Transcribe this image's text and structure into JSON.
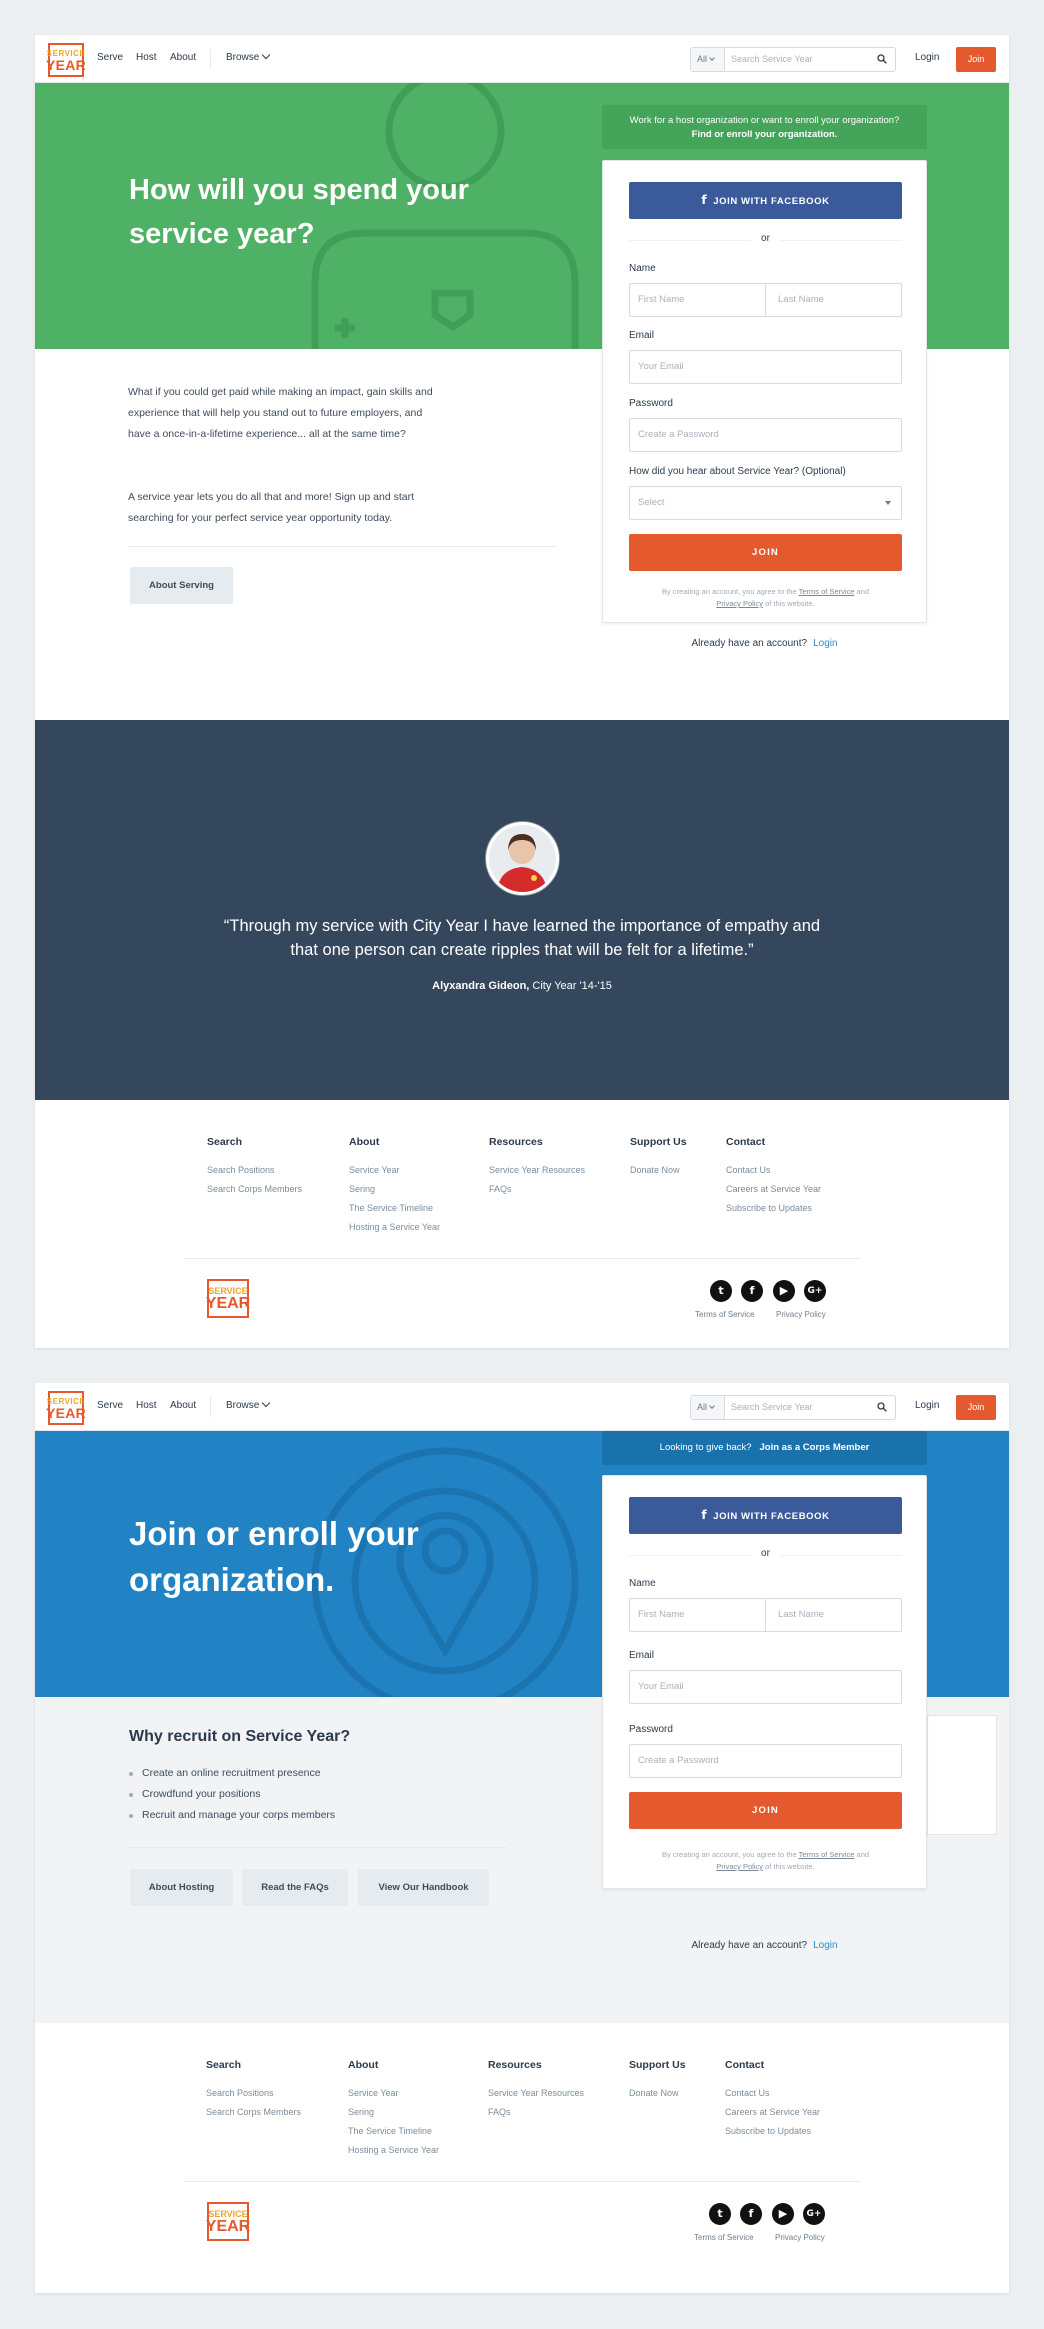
{
  "nav": {
    "logo_top": "SERVICE",
    "logo_bottom": "YEAR",
    "links": [
      "Serve",
      "Host",
      "About"
    ],
    "browse": "Browse",
    "search_category": "All",
    "search_placeholder": "Search Service Year",
    "login": "Login",
    "join": "Join"
  },
  "serve_page": {
    "hero_title": "How will you spend your service year?",
    "banner_line1": "Work for a host organization or want to enroll your organization?",
    "banner_line2": "Find or enroll your organization.",
    "intro_p1": "What if you could get paid while making an impact, gain skills and experience that will help you stand out to future employers, and have a once-in-a-lifetime experience... all at the same time?",
    "intro_p2": "A service year lets you do all that and more! Sign up and start searching for your perfect service year opportunity today.",
    "about_button": "About Serving",
    "form": {
      "facebook": "JOIN WITH FACEBOOK",
      "or": "or",
      "name_label": "Name",
      "first_placeholder": "First Name",
      "last_placeholder": "Last Name",
      "email_label": "Email",
      "email_placeholder": "Your Email",
      "password_label": "Password",
      "password_placeholder": "Create a Password",
      "hear_label": "How did you hear about Service Year? (Optional)",
      "hear_placeholder": "Select",
      "submit": "JOIN",
      "terms_pre": "By creating an account, you agree to the ",
      "terms_link": "Terms of Service",
      "terms_and": " and ",
      "privacy_link": "Privacy Policy",
      "terms_post": " of this website."
    },
    "already": "Already have an account?",
    "already_login": "Login",
    "quote": "“Through my service with City Year I have learned the importance of empathy and that one person can create ripples that will be felt for a lifetime.”",
    "author_name": "Alyxandra Gideon,",
    "author_org": " City Year '14-'15"
  },
  "host_page": {
    "hero_title": "Join or enroll your organization.",
    "banner_pre": "Looking to give back?",
    "banner_link": "Join as a Corps Member",
    "recruit_title": "Why recruit on Service Year?",
    "bullets": [
      "Create an online recruitment presence",
      "Crowdfund your positions",
      "Recruit and manage your corps members"
    ],
    "buttons": [
      "About Hosting",
      "Read the FAQs",
      "View Our Handbook"
    ],
    "form": {
      "facebook": "JOIN WITH FACEBOOK",
      "or": "or",
      "name_label": "Name",
      "first_placeholder": "First Name",
      "last_placeholder": "Last Name",
      "email_label": "Email",
      "email_placeholder": "Your Email",
      "password_label": "Password",
      "password_placeholder": "Create a Password",
      "submit": "JOIN",
      "terms_pre": "By creating an account, you agree to the ",
      "terms_link": "Terms of Service",
      "terms_and": " and ",
      "privacy_link": "Privacy Policy",
      "terms_post": " of this website."
    },
    "already": "Already have an account?",
    "already_login": "Login"
  },
  "footer": {
    "columns": [
      {
        "heading": "Search",
        "links": [
          "Search Positions",
          "Search Corps Members"
        ]
      },
      {
        "heading": "About",
        "links": [
          "Service Year",
          "Sering",
          "The Service Timeline",
          "Hosting a Service Year"
        ]
      },
      {
        "heading": "Resources",
        "links": [
          "Service Year Resources",
          "FAQs"
        ]
      },
      {
        "heading": "Support Us",
        "links": [
          "Donate Now"
        ]
      },
      {
        "heading": "Contact",
        "links": [
          "Contact Us",
          "Careers at Service Year",
          "Subscribe to Updates"
        ]
      }
    ],
    "social": [
      "twitter-icon",
      "facebook-icon",
      "youtube-icon",
      "google-plus-icon"
    ],
    "terms": "Terms of Service",
    "privacy": "Privacy Policy"
  },
  "colors": {
    "green_hero": "#4fb165",
    "blue_hero": "#2183c3",
    "accent_orange": "#e45a2e",
    "facebook_blue": "#3b5a9a",
    "testimonial_bg": "#35475d"
  }
}
